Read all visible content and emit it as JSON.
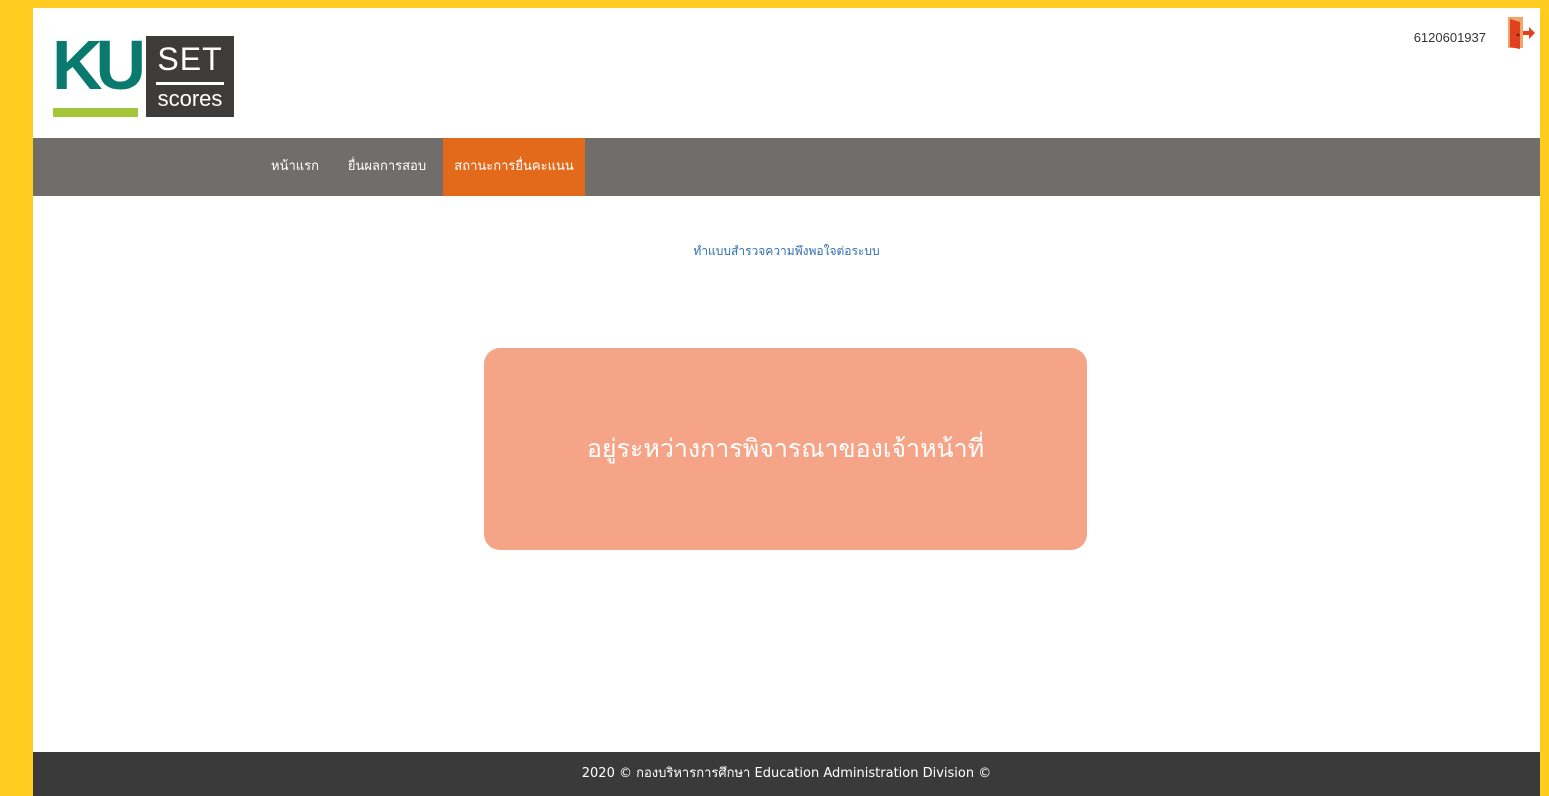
{
  "header": {
    "logo_ku": "KU",
    "logo_set": "SET",
    "logo_scores": "scores",
    "user_id": "6120601937",
    "logout_icon": "logout-door-icon"
  },
  "nav": {
    "items": [
      {
        "label": "หน้าแรก",
        "active": false
      },
      {
        "label": "ยื่นผลการสอบ",
        "active": false
      },
      {
        "label": "สถานะการยื่นคะแนน",
        "active": true
      }
    ]
  },
  "main": {
    "survey_link": "ทำแบบสำรวจความพึงพอใจต่อระบบ",
    "status_text": "อยู่ระหว่างการพิจารณาของเจ้าหน้าที่"
  },
  "footer": {
    "text": "2020 © กองบริหารการศึกษา Education Administration Division ©"
  },
  "colors": {
    "page_border": "#FFCC1F",
    "nav_bg": "#716D6B",
    "nav_active": "#E46A1B",
    "status_box": "#F6A488",
    "footer_bg": "#3A3A3A",
    "link": "#2F6FB0",
    "logo_teal": "#0A7A6E",
    "logo_green": "#A5C63B"
  }
}
